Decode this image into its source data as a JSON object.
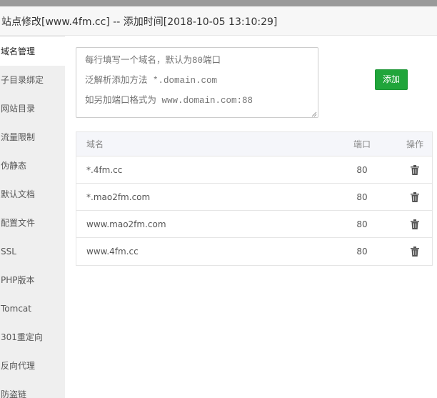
{
  "header": {
    "title": "站点修改[www.4fm.cc] -- 添加时间[2018-10-05 13:10:29]"
  },
  "sidebar": {
    "items": [
      {
        "label": "域名管理",
        "active": true
      },
      {
        "label": "子目录绑定"
      },
      {
        "label": "网站目录"
      },
      {
        "label": "流量限制"
      },
      {
        "label": "伪静态"
      },
      {
        "label": "默认文档"
      },
      {
        "label": "配置文件"
      },
      {
        "label": "SSL"
      },
      {
        "label": "PHP版本"
      },
      {
        "label": "Tomcat"
      },
      {
        "label": "301重定向"
      },
      {
        "label": "反向代理"
      },
      {
        "label": "防盗链"
      }
    ]
  },
  "domain_form": {
    "placeholder": "每行填写一个域名，默认为80端口\n泛解析添加方法 *.domain.com\n如另加端口格式为 www.domain.com:88",
    "add_label": "添加"
  },
  "table": {
    "headers": {
      "domain": "域名",
      "port": "端口",
      "action": "操作"
    },
    "rows": [
      {
        "domain": "*.4fm.cc",
        "port": "80",
        "action_icon": "trash-icon"
      },
      {
        "domain": "*.mao2fm.com",
        "port": "80",
        "action_icon": "trash-icon"
      },
      {
        "domain": "www.mao2fm.com",
        "port": "80",
        "action_icon": "trash-icon"
      },
      {
        "domain": "www.4fm.cc",
        "port": "80",
        "action_icon": "trash-icon"
      }
    ]
  },
  "colors": {
    "accent_green": "#20a53a",
    "sidebar_bg": "#efefef",
    "header_bg": "#f7f7f7",
    "table_header_bg": "#f5f6fa"
  }
}
